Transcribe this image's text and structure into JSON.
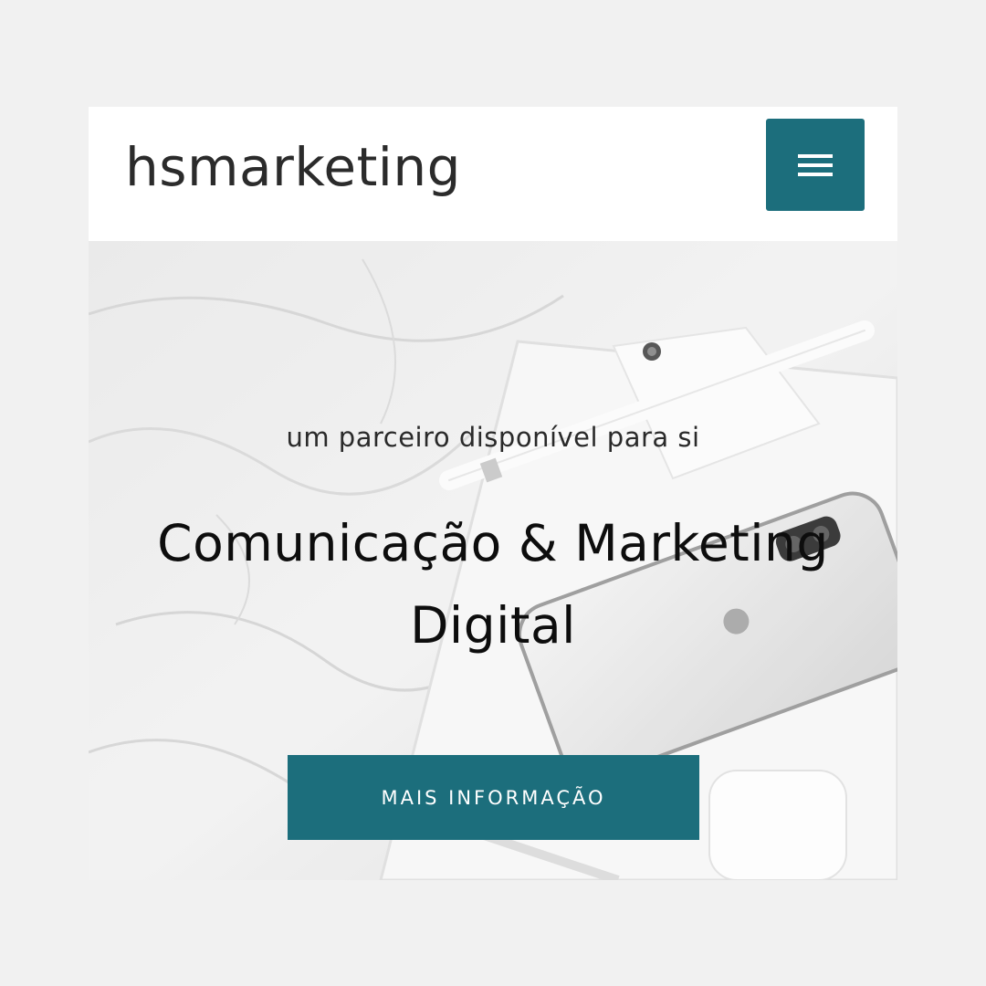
{
  "header": {
    "logo_text": "hsmarketing",
    "menu_icon": "hamburger-menu-icon"
  },
  "hero": {
    "tagline": "um parceiro disponível para si",
    "headline": "Comunicação & Marketing Digital",
    "cta_label": "MAIS INFORMAÇÃO",
    "background_image": "white crumpled sheet with tablet, smartphone, stylus pen and earbuds case"
  },
  "colors": {
    "page_background": "#f1f1f1",
    "accent": "#1c6e7c",
    "header_background": "#ffffff",
    "text_dark": "#0d0d0d"
  }
}
